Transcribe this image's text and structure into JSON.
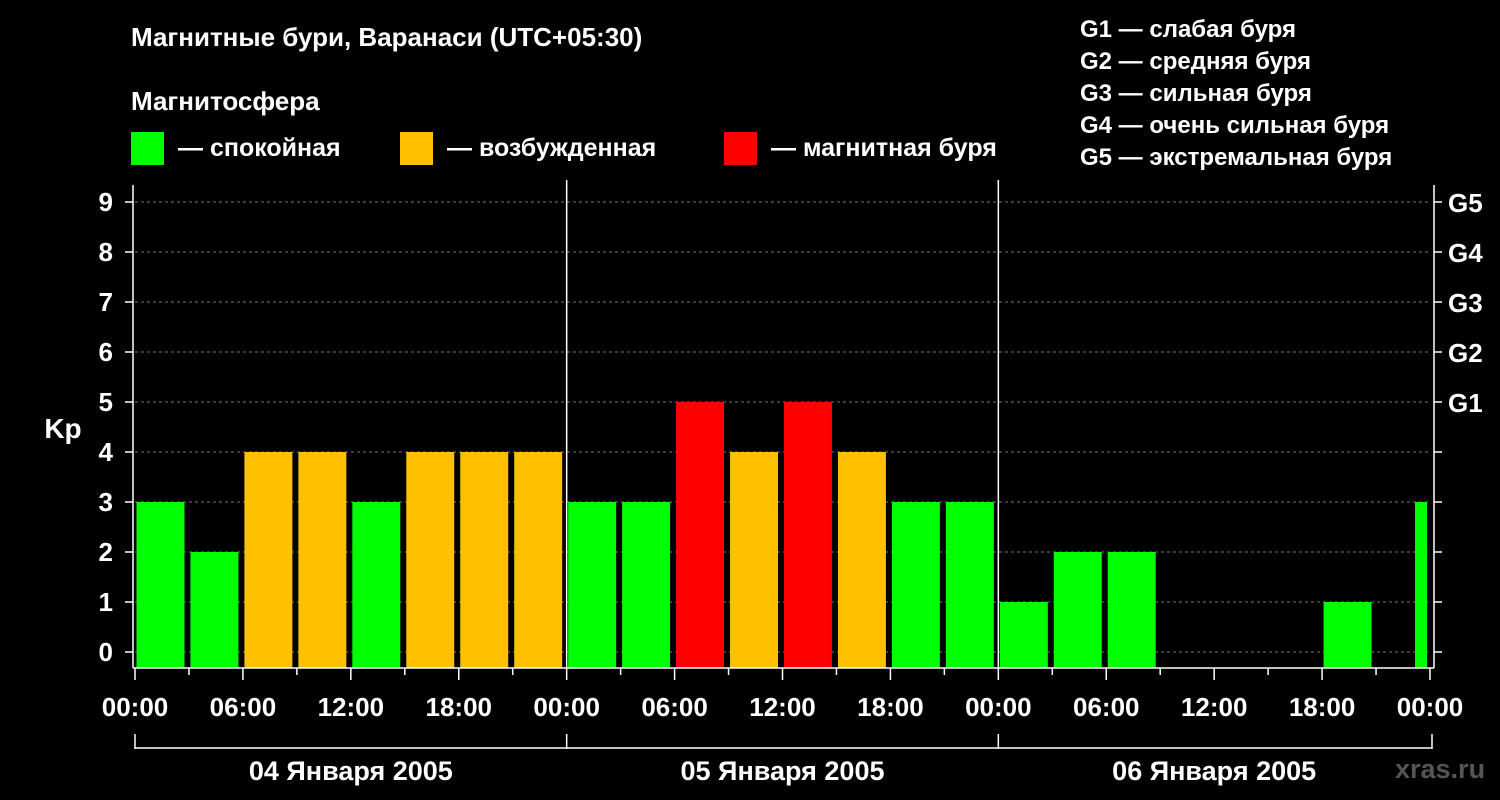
{
  "title": "Магнитные бури, Варанаси (UTC+05:30)",
  "subtitle": "Магнитосфера",
  "legend": [
    {
      "label": "— спокойная",
      "color": "#00ff00"
    },
    {
      "label": "— возбужденная",
      "color": "#ffc000"
    },
    {
      "label": "— магнитная буря",
      "color": "#ff0000"
    }
  ],
  "g_legend": [
    "G1 — слабая буря",
    "G2 — средняя буря",
    "G3 — сильная буря",
    "G4 — очень сильная буря",
    "G5 — экстремальная буря"
  ],
  "watermark": "xras.ru",
  "chart_data": {
    "type": "bar",
    "ylabel": "Kp",
    "ylim": [
      0,
      9
    ],
    "yticks": [
      "0",
      "1",
      "2",
      "3",
      "4",
      "5",
      "6",
      "7",
      "8",
      "9"
    ],
    "y2_ticks": [
      {
        "value": 5,
        "label": "G1"
      },
      {
        "value": 6,
        "label": "G2"
      },
      {
        "value": 7,
        "label": "G3"
      },
      {
        "value": 8,
        "label": "G4"
      },
      {
        "value": 9,
        "label": "G5"
      }
    ],
    "grid": "horizontal dashed",
    "x_tick_labels": [
      "00:00",
      "06:00",
      "12:00",
      "18:00",
      "00:00",
      "06:00",
      "12:00",
      "18:00",
      "00:00",
      "06:00",
      "12:00",
      "18:00",
      "00:00"
    ],
    "days": [
      "04 Января 2005",
      "05 Января 2005",
      "06 Января 2005"
    ],
    "categories": [
      "04.01 00:00",
      "04.01 03:00",
      "04.01 06:00",
      "04.01 09:00",
      "04.01 12:00",
      "04.01 15:00",
      "04.01 18:00",
      "04.01 21:00",
      "05.01 00:00",
      "05.01 03:00",
      "05.01 06:00",
      "05.01 09:00",
      "05.01 12:00",
      "05.01 15:00",
      "05.01 18:00",
      "05.01 21:00",
      "06.01 00:00",
      "06.01 03:00",
      "06.01 06:00",
      "06.01 09:00",
      "06.01 12:00",
      "06.01 15:00",
      "06.01 18:00",
      "06.01 21:00",
      "07.01 00:00"
    ],
    "values": [
      3,
      2,
      4,
      4,
      3,
      4,
      4,
      4,
      3,
      3,
      5,
      4,
      5,
      4,
      3,
      3,
      1,
      2,
      2,
      null,
      null,
      null,
      1,
      3
    ],
    "status": [
      "quiet",
      "quiet",
      "excited",
      "excited",
      "quiet",
      "excited",
      "excited",
      "excited",
      "quiet",
      "quiet",
      "storm",
      "excited",
      "storm",
      "excited",
      "quiet",
      "quiet",
      "quiet",
      "quiet",
      "quiet",
      null,
      null,
      null,
      "quiet",
      "quiet"
    ],
    "colors": {
      "quiet": "#00ff00",
      "excited": "#ffc000",
      "storm": "#ff0000"
    }
  }
}
